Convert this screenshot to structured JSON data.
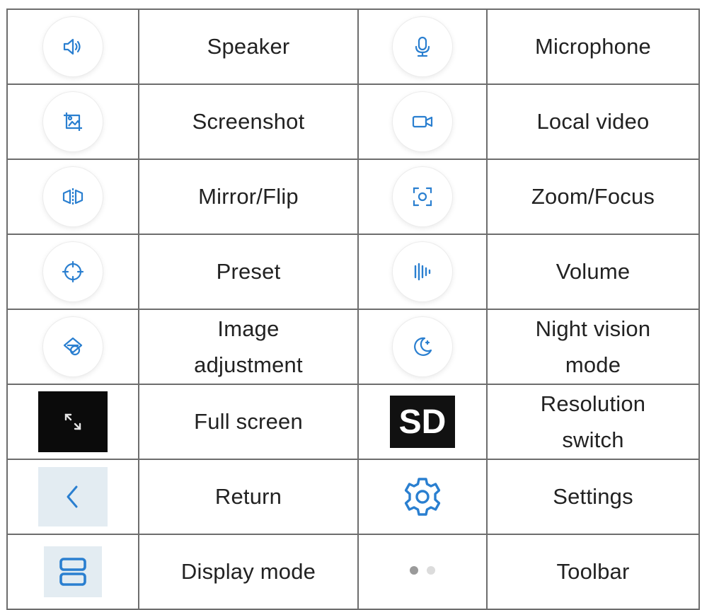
{
  "colors": {
    "icon_blue": "#2a7fd0",
    "grid_line": "#6d6d6d",
    "text": "#222222",
    "dot_active": "#9a9a9a",
    "dot_inactive": "#dcdcdc"
  },
  "rows": [
    {
      "left": {
        "icon": "speaker-icon",
        "label": "Speaker"
      },
      "right": {
        "icon": "microphone-icon",
        "label": "Microphone"
      }
    },
    {
      "left": {
        "icon": "screenshot-icon",
        "label": "Screenshot"
      },
      "right": {
        "icon": "video-camera-icon",
        "label": "Local video"
      }
    },
    {
      "left": {
        "icon": "mirror-flip-icon",
        "label": "Mirror/Flip"
      },
      "right": {
        "icon": "zoom-focus-icon",
        "label": "Zoom/Focus"
      }
    },
    {
      "left": {
        "icon": "preset-crosshair-icon",
        "label": "Preset"
      },
      "right": {
        "icon": "volume-bars-icon",
        "label": "Volume"
      }
    },
    {
      "left": {
        "icon": "image-adjustment-icon",
        "label": "Image adjustment"
      },
      "right": {
        "icon": "night-vision-moon-icon",
        "label": "Night vision mode"
      }
    },
    {
      "left": {
        "icon": "full-screen-icon",
        "label": "Full screen"
      },
      "right": {
        "icon": "sd-badge-icon",
        "label": "Resolution switch",
        "badge_text": "SD"
      }
    },
    {
      "left": {
        "icon": "back-chevron-icon",
        "label": "Return"
      },
      "right": {
        "icon": "gear-icon",
        "label": "Settings"
      }
    },
    {
      "left": {
        "icon": "display-mode-icon",
        "label": "Display mode"
      },
      "right": {
        "icon": "toolbar-dots-icon",
        "label": "Toolbar"
      }
    }
  ]
}
